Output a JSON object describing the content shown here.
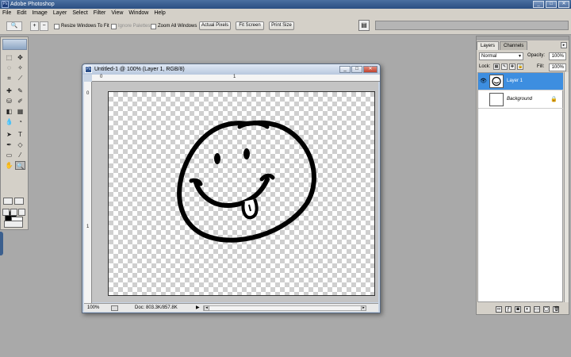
{
  "app": {
    "title": "Adobe Photoshop"
  },
  "window_controls": {
    "minimize": "_",
    "maximize": "□",
    "close": "✕"
  },
  "menu": [
    "File",
    "Edit",
    "Image",
    "Layer",
    "Select",
    "Filter",
    "View",
    "Window",
    "Help"
  ],
  "options_bar": {
    "resize_windows": "Resize Windows To Fit",
    "ignore_palettes": "Ignore Palettes",
    "zoom_all_windows": "Zoom All Windows",
    "actual_pixels": "Actual Pixels",
    "fit_screen": "Fit Screen",
    "print_size": "Print Size"
  },
  "document": {
    "title": "Untitled-1 @ 100% (Layer 1, RGB/8)",
    "zoom": "100%",
    "doc_info": "Doc: 803.3K/857.8K",
    "ruler_h": [
      "0",
      "1"
    ],
    "ruler_v": [
      "0",
      "1"
    ]
  },
  "layers_panel": {
    "tabs": [
      "Layers",
      "Channels"
    ],
    "blend_mode": "Normal",
    "opacity_label": "Opacity:",
    "opacity_value": "100%",
    "lock_label": "Lock:",
    "fill_label": "Fill:",
    "fill_value": "100%",
    "layers": [
      {
        "name": "Layer 1",
        "selected": true,
        "visible": true
      },
      {
        "name": "Background",
        "selected": false,
        "visible": false,
        "locked": true
      }
    ]
  },
  "colors": {
    "accent": "#3d8ee0",
    "workspace": "#a9a9a9",
    "chrome": "#d4d0c8"
  }
}
